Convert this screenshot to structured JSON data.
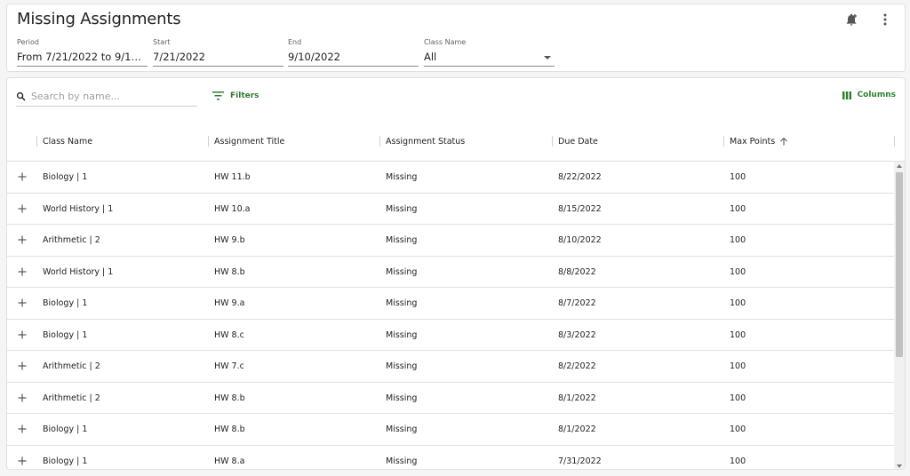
{
  "header": {
    "title": "Missing Assignments",
    "icons": [
      "bell-plus-icon",
      "more-vertical-icon"
    ]
  },
  "filters": {
    "period": {
      "label": "Period",
      "value": "From 7/21/2022 to 9/1…"
    },
    "start": {
      "label": "Start",
      "value": "7/21/2022"
    },
    "end": {
      "label": "End",
      "value": "9/10/2022"
    },
    "class_name": {
      "label": "Class Name",
      "value": "All"
    }
  },
  "toolbar": {
    "search_placeholder": "Search by name...",
    "filters_label": "Filters",
    "columns_label": "Columns",
    "accent_color": "#2e7d32"
  },
  "columns": [
    "Class Name",
    "Assignment Title",
    "Assignment Status",
    "Due Date",
    "Max Points"
  ],
  "sort": {
    "column": "Max Points",
    "direction": "asc"
  },
  "rows": [
    [
      "Biology | 1",
      "HW 11.b",
      "Missing",
      "8/22/2022",
      "100"
    ],
    [
      "World History | 1",
      "HW 10.a",
      "Missing",
      "8/15/2022",
      "100"
    ],
    [
      "Arithmetic | 2",
      "HW 9.b",
      "Missing",
      "8/10/2022",
      "100"
    ],
    [
      "World History | 1",
      "HW 8.b",
      "Missing",
      "8/8/2022",
      "100"
    ],
    [
      "Biology | 1",
      "HW 9.a",
      "Missing",
      "8/7/2022",
      "100"
    ],
    [
      "Biology | 1",
      "HW 8.c",
      "Missing",
      "8/3/2022",
      "100"
    ],
    [
      "Arithmetic | 2",
      "HW 7.c",
      "Missing",
      "8/2/2022",
      "100"
    ],
    [
      "Arithmetic | 2",
      "HW 8.b",
      "Missing",
      "8/1/2022",
      "100"
    ],
    [
      "Biology | 1",
      "HW 8.b",
      "Missing",
      "8/1/2022",
      "100"
    ],
    [
      "Biology | 1",
      "HW 8.a",
      "Missing",
      "7/31/2022",
      "100"
    ]
  ]
}
